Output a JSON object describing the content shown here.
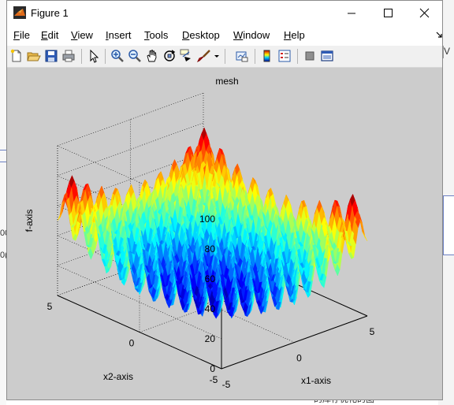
{
  "window": {
    "title": "Figure 1"
  },
  "menu": [
    {
      "key": "F",
      "rest": "ile"
    },
    {
      "key": "E",
      "rest": "dit"
    },
    {
      "key": "V",
      "rest": "iew"
    },
    {
      "key": "I",
      "rest": "nsert"
    },
    {
      "key": "T",
      "rest": "ools"
    },
    {
      "key": "D",
      "rest": "esktop"
    },
    {
      "key": "W",
      "rest": "indow"
    },
    {
      "key": "H",
      "rest": "elp"
    }
  ],
  "toolbar": {
    "icons": [
      "new-figure-icon",
      "open-file-icon",
      "save-icon",
      "print-icon",
      "edit-plot-arrow-icon",
      "zoom-in-icon",
      "zoom-out-icon",
      "pan-hand-icon",
      "rotate-3d-icon",
      "data-cursor-icon",
      "brush-icon",
      "brush-dropdown-icon",
      "link-plot-icon",
      "colorbar-icon",
      "legend-icon",
      "hide-plot-tools-icon",
      "show-plot-tools-icon"
    ]
  },
  "plot": {
    "title": "mesh",
    "xlabel": "x1-axis",
    "ylabel": "x2-axis",
    "zlabel": "f-axis",
    "x_ticks": [
      "-5",
      "0",
      "5"
    ],
    "y_ticks": [
      "5",
      "0",
      "-5"
    ],
    "z_ticks": [
      "0",
      "20",
      "40",
      "60",
      "80",
      "100"
    ]
  },
  "chart_data": {
    "type": "surface",
    "title": "mesh",
    "xlabel": "x1-axis",
    "ylabel": "x2-axis",
    "zlabel": "f-axis",
    "xlim": [
      -5,
      5
    ],
    "ylim": [
      -5,
      5
    ],
    "zlim": [
      0,
      100
    ],
    "colormap": "jet",
    "grid": true
  },
  "background": {
    "left_fragments": [
      "00",
      "0("
    ],
    "right_fragment": "V",
    "bottom_fragment": "的库存优化的图"
  }
}
